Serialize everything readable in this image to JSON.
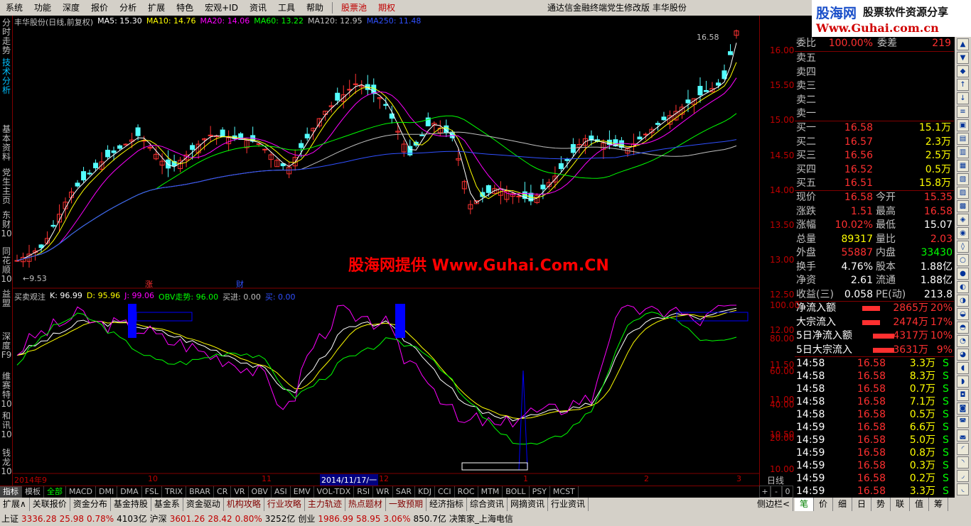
{
  "menu": {
    "items": [
      "系统",
      "功能",
      "深度",
      "报价",
      "分析",
      "扩展",
      "特色",
      "宏观+ID",
      "资讯",
      "工具",
      "帮助"
    ],
    "red_items": [
      "股票池",
      "期权"
    ],
    "title": "通达信金融终端党生修改版",
    "stock_name": "丰华股份"
  },
  "logo": {
    "cn": "股海网",
    "slogan": "股票软件资源分享",
    "url": "Www.Guhai.com.cn"
  },
  "left_tabs": [
    {
      "label": "分时走势",
      "active": false
    },
    {
      "label": "技术分析",
      "active": true
    },
    {
      "label": "基本资料",
      "active": false
    },
    {
      "label": "党生主页",
      "active": false
    },
    {
      "label": "东财10",
      "active": false
    },
    {
      "label": "同花顺10",
      "active": false
    },
    {
      "label": "益盟",
      "active": false
    },
    {
      "label": "深度F9",
      "active": false
    },
    {
      "label": "维赛特10",
      "active": false
    },
    {
      "label": "和讯10",
      "active": false
    },
    {
      "label": "钱龙10",
      "active": false
    }
  ],
  "price_header": {
    "name": "丰华股份(日线,前复权)",
    "ma5": "MA5: 15.30",
    "ma10": "MA10: 14.76",
    "ma20": "MA20: 14.06",
    "ma60": "MA60: 13.22",
    "ma120": "MA120: 12.95",
    "ma250": "MA250: 11.48"
  },
  "indicator_header": {
    "name": "买卖观注",
    "k": "K: 96.99",
    "d": "D: 95.96",
    "j": "J: 99.06",
    "obv": "OBV走势: 96.00",
    "buy_in": "买进: 0.00",
    "buy": "买: 0.00"
  },
  "price_scale": [
    "16.00",
    "15.50",
    "15.00",
    "14.50",
    "14.00",
    "13.50",
    "13.00",
    "12.50",
    "12.00",
    "11.50",
    "11.00",
    "10.50",
    "10.00"
  ],
  "ind_scale": [
    "100.00",
    "80.00",
    "60.00",
    "40.00",
    "20.00"
  ],
  "annotations": {
    "high": "16.58",
    "low": "9.53",
    "zhang": "涨",
    "cai": "财"
  },
  "x_axis": [
    "2014年9",
    "10",
    "11",
    "2014/11/17/一",
    "12",
    "1",
    "2",
    "3"
  ],
  "watermark": "股海网提供 Www.Guhai.Com.CN",
  "quote": {
    "weibi": {
      "label": "委比",
      "value": "100.00%",
      "label2": "委差",
      "value2": "219"
    },
    "sells": [
      "卖五",
      "卖四",
      "卖三",
      "卖二",
      "卖一"
    ],
    "buys": [
      {
        "label": "买一",
        "price": "16.58",
        "vol": "15.1万"
      },
      {
        "label": "买二",
        "price": "16.57",
        "vol": "2.3万"
      },
      {
        "label": "买三",
        "price": "16.56",
        "vol": "2.5万"
      },
      {
        "label": "买四",
        "price": "16.52",
        "vol": "0.5万"
      },
      {
        "label": "买五",
        "price": "16.51",
        "vol": "15.8万"
      }
    ],
    "stats": [
      {
        "l1": "现价",
        "v1": "16.58",
        "l2": "今开",
        "v2": "15.35",
        "c1": "#ff3030",
        "c2": "#ff3030"
      },
      {
        "l1": "涨跌",
        "v1": "1.51",
        "l2": "最高",
        "v2": "16.58",
        "c1": "#ff3030",
        "c2": "#ff3030"
      },
      {
        "l1": "涨幅",
        "v1": "10.02%",
        "l2": "最低",
        "v2": "15.07",
        "c1": "#ff3030",
        "c2": "#ffffff"
      },
      {
        "l1": "总量",
        "v1": "89317",
        "l2": "量比",
        "v2": "2.03",
        "c1": "#ffff00",
        "c2": "#ff3030"
      },
      {
        "l1": "外盘",
        "v1": "55887",
        "l2": "内盘",
        "v2": "33430",
        "c1": "#ff3030",
        "c2": "#00ff00"
      },
      {
        "l1": "换手",
        "v1": "4.76%",
        "l2": "股本",
        "v2": "1.88亿",
        "c1": "#ffffff",
        "c2": "#ffffff"
      },
      {
        "l1": "净资",
        "v1": "2.61",
        "l2": "流通",
        "v2": "1.88亿",
        "c1": "#ffffff",
        "c2": "#ffffff"
      },
      {
        "l1": "收益(三)",
        "v1": "0.058",
        "l2": "PE(动)",
        "v2": "213.8",
        "c1": "#ffffff",
        "c2": "#ffffff"
      }
    ],
    "flows": [
      {
        "label": "净流入额",
        "value": "2865万",
        "pct": "20%"
      },
      {
        "label": "大宗流入",
        "value": "2474万",
        "pct": "17%"
      },
      {
        "label": "5日净流入额",
        "value": "4317万",
        "pct": "10%"
      },
      {
        "label": "5日大宗流入",
        "value": "3631万",
        "pct": "9%"
      }
    ],
    "ticks": [
      {
        "time": "14:58",
        "price": "16.58",
        "vol": "3.3万",
        "side": "S"
      },
      {
        "time": "14:58",
        "price": "16.58",
        "vol": "8.3万",
        "side": "S"
      },
      {
        "time": "14:58",
        "price": "16.58",
        "vol": "0.7万",
        "side": "S"
      },
      {
        "time": "14:58",
        "price": "16.58",
        "vol": "7.1万",
        "side": "S"
      },
      {
        "time": "14:58",
        "price": "16.58",
        "vol": "0.5万",
        "side": "S"
      },
      {
        "time": "14:59",
        "price": "16.58",
        "vol": "6.6万",
        "side": "S"
      },
      {
        "time": "14:59",
        "price": "16.58",
        "vol": "5.0万",
        "side": "S"
      },
      {
        "time": "14:59",
        "price": "16.58",
        "vol": "0.8万",
        "side": "S"
      },
      {
        "time": "14:59",
        "price": "16.58",
        "vol": "0.3万",
        "side": "S"
      },
      {
        "time": "14:59",
        "price": "16.58",
        "vol": "0.2万",
        "side": "S"
      },
      {
        "time": "14:59",
        "price": "16.58",
        "vol": "3.3万",
        "side": "S"
      }
    ]
  },
  "bottom_tabs": [
    "指标",
    "模板",
    "全部",
    "MACD",
    "DMI",
    "DMA",
    "FSL",
    "TRIX",
    "BRAR",
    "CR",
    "VR",
    "OBV",
    "ASI",
    "EMV",
    "VOL-TDX",
    "RSI",
    "WR",
    "SAR",
    "KDJ",
    "CCI",
    "ROC",
    "MTM",
    "BOLL",
    "PSY",
    "MCST"
  ],
  "period_label": "日线",
  "ctrl": [
    "+",
    "-",
    "0"
  ],
  "func_bar": [
    "扩展∧",
    "关联报价",
    "资金分布",
    "基金持股",
    "基金系",
    "资金驱动",
    "机构攻略",
    "行业攻略",
    "主力轨迹",
    "热点题材",
    "一致预期",
    "经济指标",
    "综合资讯",
    "网摘资讯",
    "行业资讯"
  ],
  "side_label": "侧边栏<",
  "right_tabs": [
    "笔",
    "价",
    "细",
    "日",
    "势",
    "联",
    "值",
    "筹"
  ],
  "status": {
    "sh_label": "上证",
    "sh": "3336.28",
    "sh_chg": "25.98",
    "sh_pct": "0.78%",
    "sh_amt": "4103亿",
    "sz_label": "沪深",
    "sz": "3601.26",
    "sz_chg": "28.42",
    "sz_pct": "0.80%",
    "sz_amt": "3252亿",
    "cy_label": "创业",
    "cy": "1986.99",
    "cy_chg": "58.95",
    "cy_pct": "3.06%",
    "cy_amt": "850.7亿",
    "broker": "决策家_上海电信"
  }
}
